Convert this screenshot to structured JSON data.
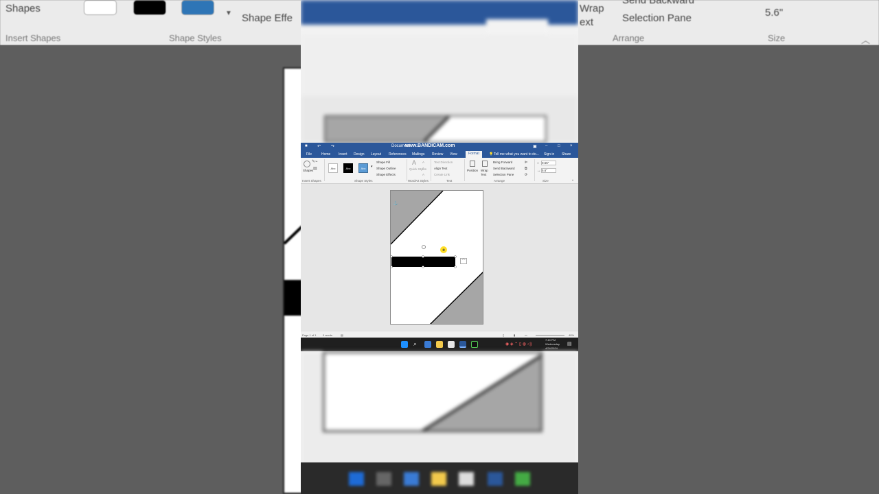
{
  "background_ribbon": {
    "items": {
      "shapes": "Shapes",
      "insert_shapes": "Insert Shapes",
      "shape_styles": "Shape Styles",
      "shape_effects": "Shape Effe",
      "wrap": "Wrap",
      "text_frag": "ext",
      "send_backward": "Send Backward",
      "selection_pane": "Selection Pane",
      "arrange": "Arrange",
      "size": "Size",
      "size_value": "5.6\""
    }
  },
  "word": {
    "title": "Document",
    "watermark": "www.BANDICAM.com",
    "tabs": [
      "File",
      "Home",
      "Insert",
      "Design",
      "Layout",
      "References",
      "Mailings",
      "Review",
      "View",
      "Format"
    ],
    "active_tab": "Format",
    "tell_me": "Tell me what you want to do...",
    "sign_in": "Sign in",
    "share": "Share",
    "ribbon": {
      "shapes_label": "Shapes",
      "insert_shapes": "Insert Shapes",
      "style_labels": [
        "Abc",
        "Abc",
        "Abc"
      ],
      "shape_fill": "Shape Fill",
      "shape_outline": "Shape Outline",
      "shape_effects": "Shape Effects",
      "shape_styles": "Shape Styles",
      "quick_styles": "Quick Styles",
      "wordart_styles": "WordArt Styles",
      "text_direction": "Text Direction",
      "align_text": "Align Text",
      "create_link": "Create Link",
      "text_group": "Text",
      "position": "Position",
      "wrap_text": "Wrap Text",
      "bring_forward": "Bring Forward",
      "send_backward": "Send Backward",
      "selection_pane": "Selection Pane",
      "arrange": "Arrange",
      "height": "0.55\"",
      "width": "5.6\"",
      "size": "Size"
    },
    "status": {
      "page": "Page 1 of 1",
      "words": "0 words",
      "zoom": "40%"
    },
    "clock": {
      "time": "7:40 PM",
      "day": "Wednesday",
      "date": "4/24/2024"
    }
  },
  "colors": {
    "word_blue": "#2b579a",
    "gray_shape": "#a6a6a6",
    "selected_bar": "#000000"
  }
}
